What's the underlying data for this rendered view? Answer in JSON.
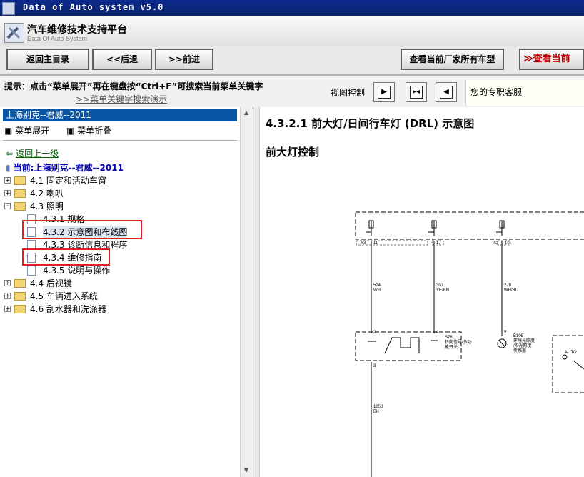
{
  "window": {
    "title": "Data of Auto system v5.0"
  },
  "header": {
    "brand": "汽车维修技术支持平台",
    "brand_sub": "Data Of Auto System"
  },
  "toolbar": {
    "home": "返回主目录",
    "back": "<<后退",
    "forward": ">>前进",
    "all_models": "查看当前厂家所有车型",
    "view_current": "查看当前"
  },
  "tipbar": {
    "tip": "提示：点击“菜单展开”再在键盘按“Ctrl+F”可搜索当前菜单关键字",
    "link": ">>菜单关键字搜索演示",
    "view_control_label": "视图控制",
    "support": "您的专职客服"
  },
  "sidebar": {
    "car": "上海别克--君威--2011",
    "expand": "菜单展开",
    "collapse": "菜单折叠",
    "back_up": "返回上一级",
    "current": "当前:上海别克--君威--2011",
    "tree": [
      {
        "label": "4.1 固定和活动车窗",
        "type": "folder",
        "state": "+"
      },
      {
        "label": "4.2 喇叭",
        "type": "folder",
        "state": "+"
      },
      {
        "label": "4.3 照明",
        "type": "folder",
        "state": "-"
      },
      {
        "label": "4.3.1 规格",
        "type": "doc"
      },
      {
        "label": "4.3.2 示意图和布线图",
        "type": "doc",
        "highlight": true
      },
      {
        "label": "4.3.3 诊断信息和程序",
        "type": "doc"
      },
      {
        "label": "4.3.4 维修指南",
        "type": "doc",
        "highlight": true
      },
      {
        "label": "4.3.5 说明与操作",
        "type": "doc"
      },
      {
        "label": "4.4 后视镜",
        "type": "folder",
        "state": "+"
      },
      {
        "label": "4.5 车辆进入系统",
        "type": "folder",
        "state": "+"
      },
      {
        "label": "4.6 刮水器和洗涤器",
        "type": "folder",
        "state": "+"
      }
    ]
  },
  "content": {
    "title": "4.3.2.1 前大灯/日间行车灯 (DRL) 示意图",
    "subtitle": "前大灯控制",
    "diagram": {
      "connectors": [
        "X3",
        "11",
        "17",
        "X2",
        "10"
      ],
      "wires": [
        {
          "code": "524",
          "color": "WH"
        },
        {
          "code": "307",
          "color": "YE/BN"
        },
        {
          "code": "278",
          "color": "WH/BU"
        },
        {
          "code": "1850",
          "color": "BK"
        }
      ],
      "pins": [
        "2",
        "4",
        "5",
        "3"
      ],
      "s78": [
        "S78",
        "转向信号/多功",
        "能开关"
      ],
      "b105": [
        "B105",
        "环境光照度",
        "/阳光照度",
        "传感器"
      ],
      "auto": "AUTO"
    }
  }
}
